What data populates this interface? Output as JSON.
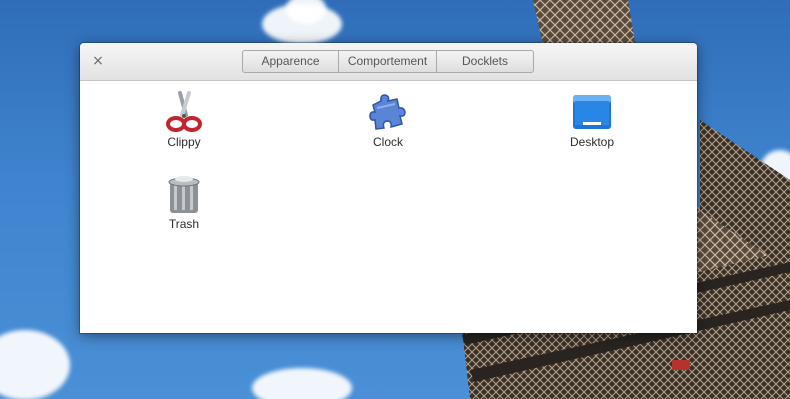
{
  "dialog": {
    "close_glyph": "×",
    "tabs": [
      {
        "label": "Apparence"
      },
      {
        "label": "Comportement"
      },
      {
        "label": "Docklets"
      }
    ],
    "docklets": [
      {
        "label": "Clippy",
        "icon": "scissors-icon"
      },
      {
        "label": "Clock",
        "icon": "puzzle-piece-icon"
      },
      {
        "label": "Desktop",
        "icon": "desktop-icon"
      },
      {
        "label": "Trash",
        "icon": "trash-can-icon"
      }
    ]
  },
  "colors": {
    "sky": "#3f84cf",
    "window_bg": "#ffffff",
    "titlebar": "#e6e6e6"
  }
}
